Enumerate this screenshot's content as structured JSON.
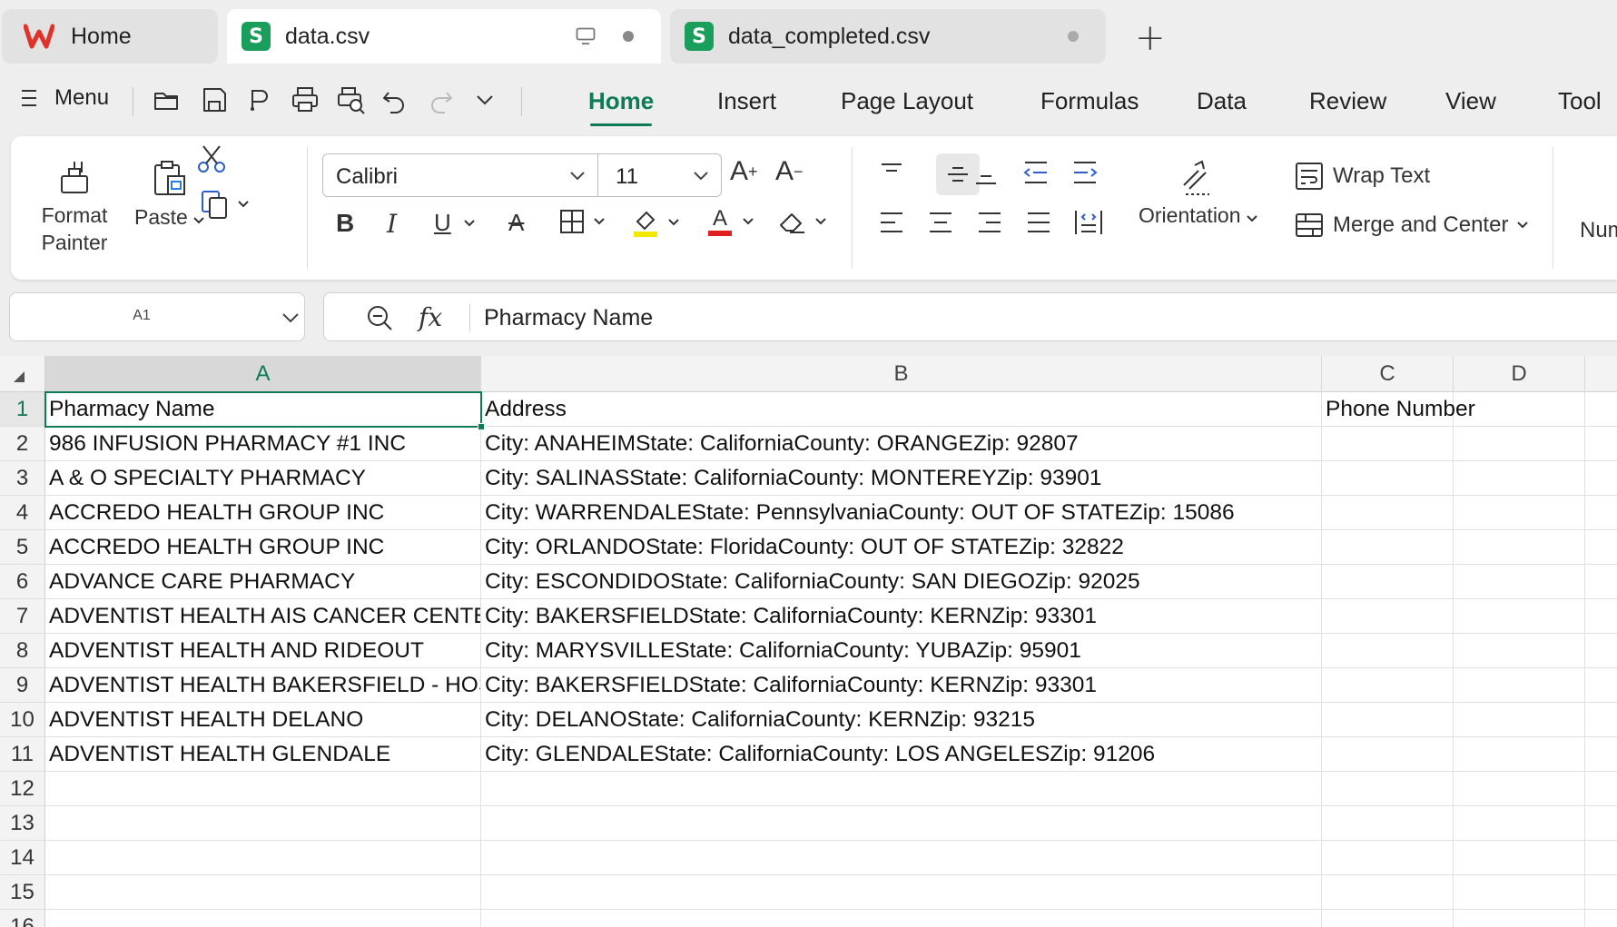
{
  "tabs": [
    {
      "label": "Home",
      "kind": "home"
    },
    {
      "label": "data.csv",
      "kind": "sheet",
      "active": true
    },
    {
      "label": "data_completed.csv",
      "kind": "sheet",
      "active": false
    }
  ],
  "menu": {
    "menu_label": "Menu",
    "ribbon_tabs": [
      "Home",
      "Insert",
      "Page Layout",
      "Formulas",
      "Data",
      "Review",
      "View",
      "Tool"
    ],
    "active_tab": "Home"
  },
  "ribbon": {
    "format_painter": "Format Painter",
    "format_painter_l1": "Format",
    "format_painter_l2": "Painter",
    "paste": "Paste",
    "font_name": "Calibri",
    "font_size": "11",
    "orientation": "Orientation",
    "wrap_text": "Wrap Text",
    "merge_center": "Merge and Center",
    "number_partial": "Num"
  },
  "formula_bar": {
    "cell_ref": "A1",
    "fx": "fx",
    "value": "Pharmacy Name"
  },
  "sheet": {
    "columns": [
      "A",
      "B",
      "C",
      "D"
    ],
    "selected_cell": "A1",
    "rows": [
      {
        "n": "1",
        "a": "Pharmacy Name",
        "b": "Address",
        "c": "Phone Number"
      },
      {
        "n": "2",
        "a": "986 INFUSION PHARMACY #1 INC",
        "b": "City: ANAHEIMState: CaliforniaCounty: ORANGEZip: 92807",
        "c": ""
      },
      {
        "n": "3",
        "a": "A & O SPECIALTY PHARMACY",
        "b": "City: SALINASState: CaliforniaCounty: MONTEREYZip: 93901",
        "c": ""
      },
      {
        "n": "4",
        "a": "ACCREDO HEALTH GROUP INC",
        "b": "City: WARRENDALEState: PennsylvaniaCounty: OUT OF STATEZip: 15086",
        "c": ""
      },
      {
        "n": "5",
        "a": "ACCREDO HEALTH GROUP INC",
        "b": "City: ORLANDOState: FloridaCounty: OUT OF STATEZip: 32822",
        "c": ""
      },
      {
        "n": "6",
        "a": "ADVANCE CARE PHARMACY",
        "b": "City: ESCONDIDOState: CaliforniaCounty: SAN DIEGOZip: 92025",
        "c": ""
      },
      {
        "n": "7",
        "a": "ADVENTIST HEALTH AIS CANCER CENTER",
        "b": "City: BAKERSFIELDState: CaliforniaCounty: KERNZip: 93301",
        "c": ""
      },
      {
        "n": "8",
        "a": "ADVENTIST HEALTH AND RIDEOUT",
        "b": "City: MARYSVILLEState: CaliforniaCounty: YUBAZip: 95901",
        "c": ""
      },
      {
        "n": "9",
        "a": "ADVENTIST HEALTH BAKERSFIELD - HOSPITAL",
        "b": "City: BAKERSFIELDState: CaliforniaCounty: KERNZip: 93301",
        "c": ""
      },
      {
        "n": "10",
        "a": "ADVENTIST HEALTH DELANO",
        "b": "City: DELANOState: CaliforniaCounty: KERNZip: 93215",
        "c": ""
      },
      {
        "n": "11",
        "a": "ADVENTIST HEALTH GLENDALE",
        "b": "City: GLENDALEState: CaliforniaCounty: LOS ANGELESZip: 91206",
        "c": ""
      },
      {
        "n": "12",
        "a": "",
        "b": "",
        "c": ""
      },
      {
        "n": "13",
        "a": "",
        "b": "",
        "c": ""
      },
      {
        "n": "14",
        "a": "",
        "b": "",
        "c": ""
      },
      {
        "n": "15",
        "a": "",
        "b": "",
        "c": ""
      },
      {
        "n": "16",
        "a": "",
        "b": "",
        "c": ""
      }
    ]
  },
  "colors": {
    "accent": "#0e7a56",
    "sheet_badge": "#1a9e5c",
    "wps_red": "#e0312b",
    "highlight_yellow": "#f5e800",
    "font_red": "#e02020"
  }
}
